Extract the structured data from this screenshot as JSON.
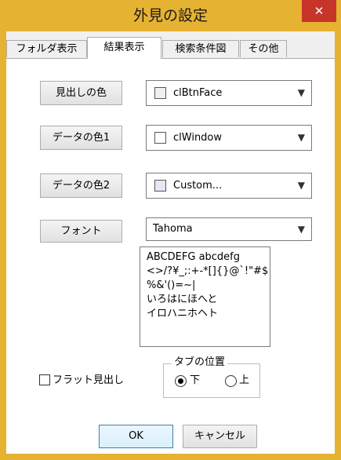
{
  "window": {
    "title": "外見の設定",
    "close_label": "✕"
  },
  "tabs": [
    "フォルダ表示",
    "結果表示",
    "検索条件図",
    "その他"
  ],
  "rows": [
    {
      "button": "見出しの色",
      "value": "clBtnFace",
      "swatch": "#f0f0f0"
    },
    {
      "button": "データの色1",
      "value": "clWindow",
      "swatch": "#ffffff"
    },
    {
      "button": "データの色2",
      "value": "Custom...",
      "swatch": "#e6e6f7"
    }
  ],
  "font": {
    "button": "フォント",
    "value": "Tahoma"
  },
  "preview": {
    "lines": [
      "ABCDEFG abcdefg",
      "<>/?¥_;:+-*[]{}@`!\"#$",
      "%&'()=~|",
      "いろはにほへと",
      "イロハニホヘト"
    ]
  },
  "flat_header": {
    "label": "フラット見出し",
    "checked": false
  },
  "tab_position": {
    "legend": "タブの位置",
    "options": [
      "下",
      "上"
    ],
    "selected": "下"
  },
  "footer": {
    "ok": "OK",
    "cancel": "キャンセル"
  },
  "colors": {
    "accent_border": "#e6b232",
    "close_red": "#c7352a"
  }
}
